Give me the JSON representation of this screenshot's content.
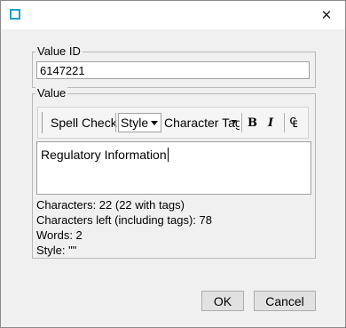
{
  "dialog": {
    "close_glyph": "✕"
  },
  "value_id": {
    "legend": "Value ID",
    "value": "6147221"
  },
  "value": {
    "legend": "Value",
    "toolbar": {
      "spell_check": "Spell Check",
      "style_label": "Style",
      "character_tags": "Character Tag",
      "bold": "B",
      "italic": "I",
      "special_glyph": "₠"
    },
    "text": "Regulatory Information",
    "stats": {
      "characters": "Characters: 22 (22 with tags)",
      "characters_left": "Characters left (including tags): 78",
      "words": "Words: 2",
      "style": "Style: \"\""
    }
  },
  "buttons": {
    "ok": "OK",
    "cancel": "Cancel"
  }
}
